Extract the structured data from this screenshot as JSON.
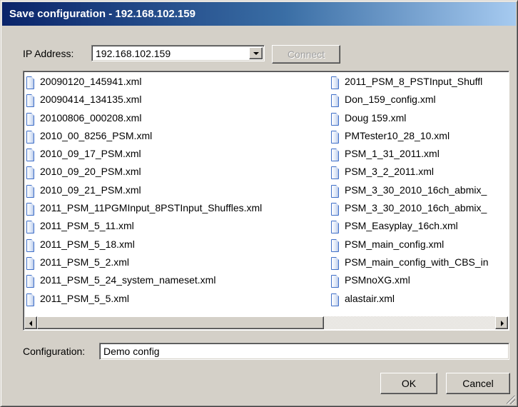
{
  "window": {
    "title": "Save configuration - 192.168.102.159"
  },
  "ip": {
    "label": "IP Address:",
    "value": "192.168.102.159",
    "connect_label": "Connect"
  },
  "files": {
    "column1": [
      "20090120_145941.xml",
      "20090414_134135.xml",
      "20100806_000208.xml",
      "2010_00_8256_PSM.xml",
      "2010_09_17_PSM.xml",
      "2010_09_20_PSM.xml",
      "2010_09_21_PSM.xml",
      "2011_PSM_11PGMInput_8PSTInput_Shuffles.xml",
      "2011_PSM_5_11.xml",
      "2011_PSM_5_18.xml",
      "2011_PSM_5_2.xml",
      "2011_PSM_5_24_system_nameset.xml",
      "2011_PSM_5_5.xml"
    ],
    "column2": [
      "2011_PSM_8_PSTInput_Shuffl",
      "Don_159_config.xml",
      "Doug 159.xml",
      "PMTester10_28_10.xml",
      "PSM_1_31_2011.xml",
      "PSM_3_2_2011.xml",
      "PSM_3_30_2010_16ch_abmix_",
      "PSM_3_30_2010_16ch_abmix_",
      "PSM_Easyplay_16ch.xml",
      "PSM_main_config.xml",
      "PSM_main_config_with_CBS_in",
      "PSMnoXG.xml",
      "alastair.xml"
    ]
  },
  "configuration": {
    "label": "Configuration:",
    "value": "Demo config"
  },
  "buttons": {
    "ok": "OK",
    "cancel": "Cancel"
  },
  "icons": {
    "file": "xml-file-icon",
    "dropdown": "chevron-down-icon",
    "scroll_left": "scroll-left-arrow-icon",
    "scroll_right": "scroll-right-arrow-icon"
  },
  "colors": {
    "title_bar_start": "#0a246a",
    "title_bar_end": "#a6caf0",
    "dialog_face": "#d4d0c8"
  }
}
